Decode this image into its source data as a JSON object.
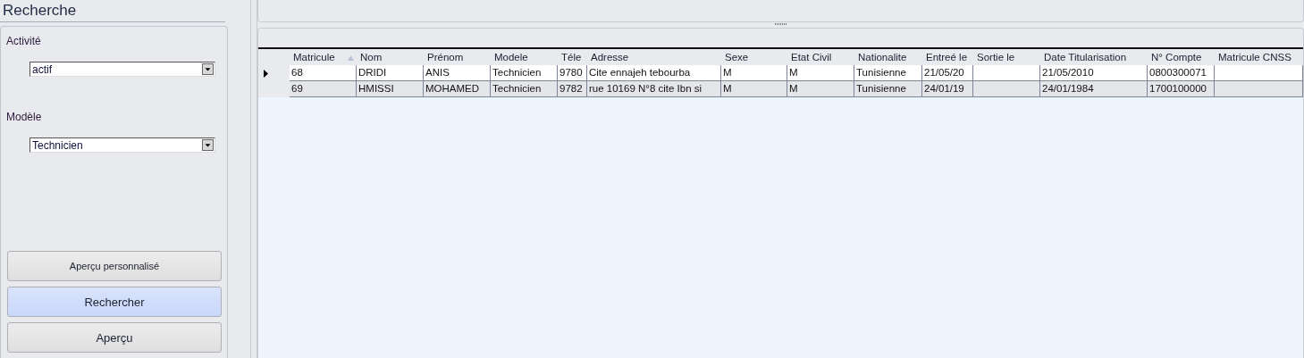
{
  "sidebar": {
    "title": "Recherche",
    "filters": [
      {
        "label": "Activité",
        "value": "actif"
      },
      {
        "label": "Modèle",
        "value": "Technicien"
      }
    ],
    "buttons": [
      {
        "label": "Aperçu personnalisé",
        "highlighted": false,
        "kind": "compact"
      },
      {
        "label": "Rechercher",
        "highlighted": true,
        "kind": "regular"
      },
      {
        "label": "Aperçu",
        "highlighted": false,
        "kind": "regular"
      }
    ]
  },
  "table": {
    "columns": [
      {
        "label": "Matricule",
        "sorted": true
      },
      {
        "label": "Nom",
        "sorted": false
      },
      {
        "label": "Prénom",
        "sorted": false
      },
      {
        "label": "Modele",
        "sorted": false
      },
      {
        "label": "Téle",
        "sorted": false
      },
      {
        "label": "Adresse",
        "sorted": false
      },
      {
        "label": "Sexe",
        "sorted": false
      },
      {
        "label": "Etat Civil",
        "sorted": false
      },
      {
        "label": "Nationalite",
        "sorted": false
      },
      {
        "label": "Entreé le",
        "sorted": false
      },
      {
        "label": "Sortie le",
        "sorted": false
      },
      {
        "label": "Date Titularisation",
        "sorted": false
      },
      {
        "label": "N° Compte",
        "sorted": false
      },
      {
        "label": "Matricule CNSS",
        "sorted": false
      }
    ],
    "rows": [
      {
        "current": true,
        "cells": [
          "68",
          "DRIDI",
          "ANIS",
          "Technicien",
          "9780",
          "Cite ennajeh tebourba",
          "M",
          "M",
          "Tunisienne",
          "21/05/20",
          "",
          "21/05/2010",
          "0800300071",
          ""
        ]
      },
      {
        "current": false,
        "cells": [
          "69",
          "HMISSI",
          "MOHAMED",
          "Technicien",
          "9782",
          "rue 10169 N°8 cite Ibn si",
          "M",
          "M",
          "Tunisienne",
          "24/01/19",
          "",
          "24/01/1984",
          "1700100000",
          ""
        ]
      }
    ]
  }
}
